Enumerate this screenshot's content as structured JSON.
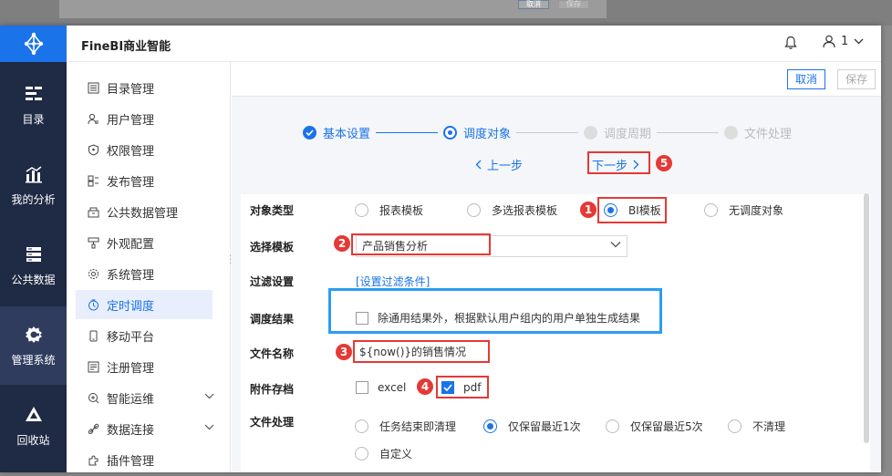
{
  "background": {
    "cancel_label": "取消",
    "save_label": "保存"
  },
  "header": {
    "app_title": "FineBI商业智能",
    "user_count": "1"
  },
  "rail": [
    {
      "label": "目录",
      "icon": "catalog-icon"
    },
    {
      "label": "我的分析",
      "icon": "analysis-icon"
    },
    {
      "label": "公共数据",
      "icon": "public-data-icon"
    },
    {
      "label": "管理系统",
      "icon": "gear-icon"
    },
    {
      "label": "回收站",
      "icon": "recycle-icon"
    }
  ],
  "menu": [
    {
      "label": "目录管理",
      "icon": "list-icon"
    },
    {
      "label": "用户管理",
      "icon": "user-icon"
    },
    {
      "label": "权限管理",
      "icon": "shield-icon"
    },
    {
      "label": "发布管理",
      "icon": "publish-icon"
    },
    {
      "label": "公共数据管理",
      "icon": "box-icon"
    },
    {
      "label": "外观配置",
      "icon": "brush-icon"
    },
    {
      "label": "系统管理",
      "icon": "settings-icon"
    },
    {
      "label": "定时调度",
      "icon": "clock-icon"
    },
    {
      "label": "移动平台",
      "icon": "mobile-icon"
    },
    {
      "label": "注册管理",
      "icon": "register-icon"
    },
    {
      "label": "智能运维",
      "icon": "ops-icon"
    },
    {
      "label": "数据连接",
      "icon": "link-icon"
    },
    {
      "label": "插件管理",
      "icon": "plugin-icon"
    }
  ],
  "toolbar": {
    "cancel_label": "取消",
    "save_label": "保存"
  },
  "steps": [
    {
      "label": "基本设置",
      "state": "done"
    },
    {
      "label": "调度对象",
      "state": "current"
    },
    {
      "label": "调度周期",
      "state": "todo"
    },
    {
      "label": "文件处理",
      "state": "todo"
    }
  ],
  "nav": {
    "prev_label": "上一步",
    "next_label": "下一步"
  },
  "form": {
    "object_type": {
      "label": "对象类型",
      "options": [
        "报表模板",
        "多选报表模板",
        "BI模板",
        "无调度对象"
      ],
      "selected": "BI模板"
    },
    "template": {
      "label": "选择模板",
      "value": "产品销售分析"
    },
    "filter": {
      "label": "过滤设置",
      "link": "[设置过滤条件]"
    },
    "result": {
      "label": "调度结果",
      "option": "除通用结果外，根据默认用户组内的用户单独生成结果",
      "checked": false
    },
    "file_name": {
      "label": "文件名称",
      "value": "${now()}的销售情况"
    },
    "attachment": {
      "label": "附件存档",
      "options": [
        {
          "label": "excel",
          "checked": false
        },
        {
          "label": "pdf",
          "checked": true
        }
      ]
    },
    "file_handling": {
      "label": "文件处理",
      "options": [
        "任务结束即清理",
        "仅保留最近1次",
        "仅保留最近5次",
        "不清理",
        "自定义"
      ],
      "selected": "仅保留最近1次"
    }
  },
  "annotations": [
    "1",
    "2",
    "3",
    "4",
    "5"
  ],
  "colors": {
    "brand": "#1a73e8",
    "rail": "#1f2a44",
    "highlight_red": "#e53935",
    "highlight_blue": "#2a9df4"
  }
}
